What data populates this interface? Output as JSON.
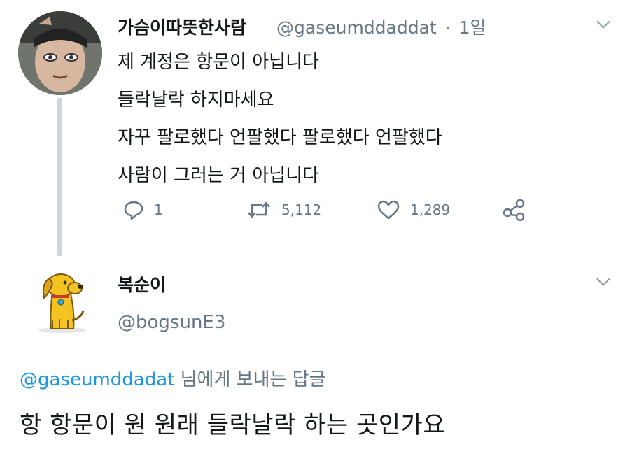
{
  "tweet": {
    "author_name": "가슴이따뜻한사람",
    "author_handle": "@gaseumddaddat",
    "separator": "·",
    "time": "1일",
    "lines": [
      "제 계정은 항문이 아닙니다",
      "들락날락 하지마세요",
      "자꾸 팔로했다 언팔했다 팔로했다 언팔했다",
      "사람이 그러는 거 아닙니다"
    ],
    "reply_count": "1",
    "retweet_count": "5,112",
    "like_count": "1,289"
  },
  "reply": {
    "author_name": "복순이",
    "author_handle": "@bogsunE3",
    "replying_to_handle": "@gaseumddadat",
    "replying_to_suffix": " 님에게 보내는 답글",
    "text": "항 항문이 원 원래 들락날락 하는 곳인가요"
  },
  "icons": {
    "tweet_menu": "chevron-down-icon",
    "reply": "reply-icon",
    "retweet": "retweet-icon",
    "like": "heart-icon",
    "share": "share-icon"
  },
  "colors": {
    "text": "#14171a",
    "muted": "#657786",
    "link": "#1b95e0",
    "thread_line": "#ccd6dd"
  }
}
